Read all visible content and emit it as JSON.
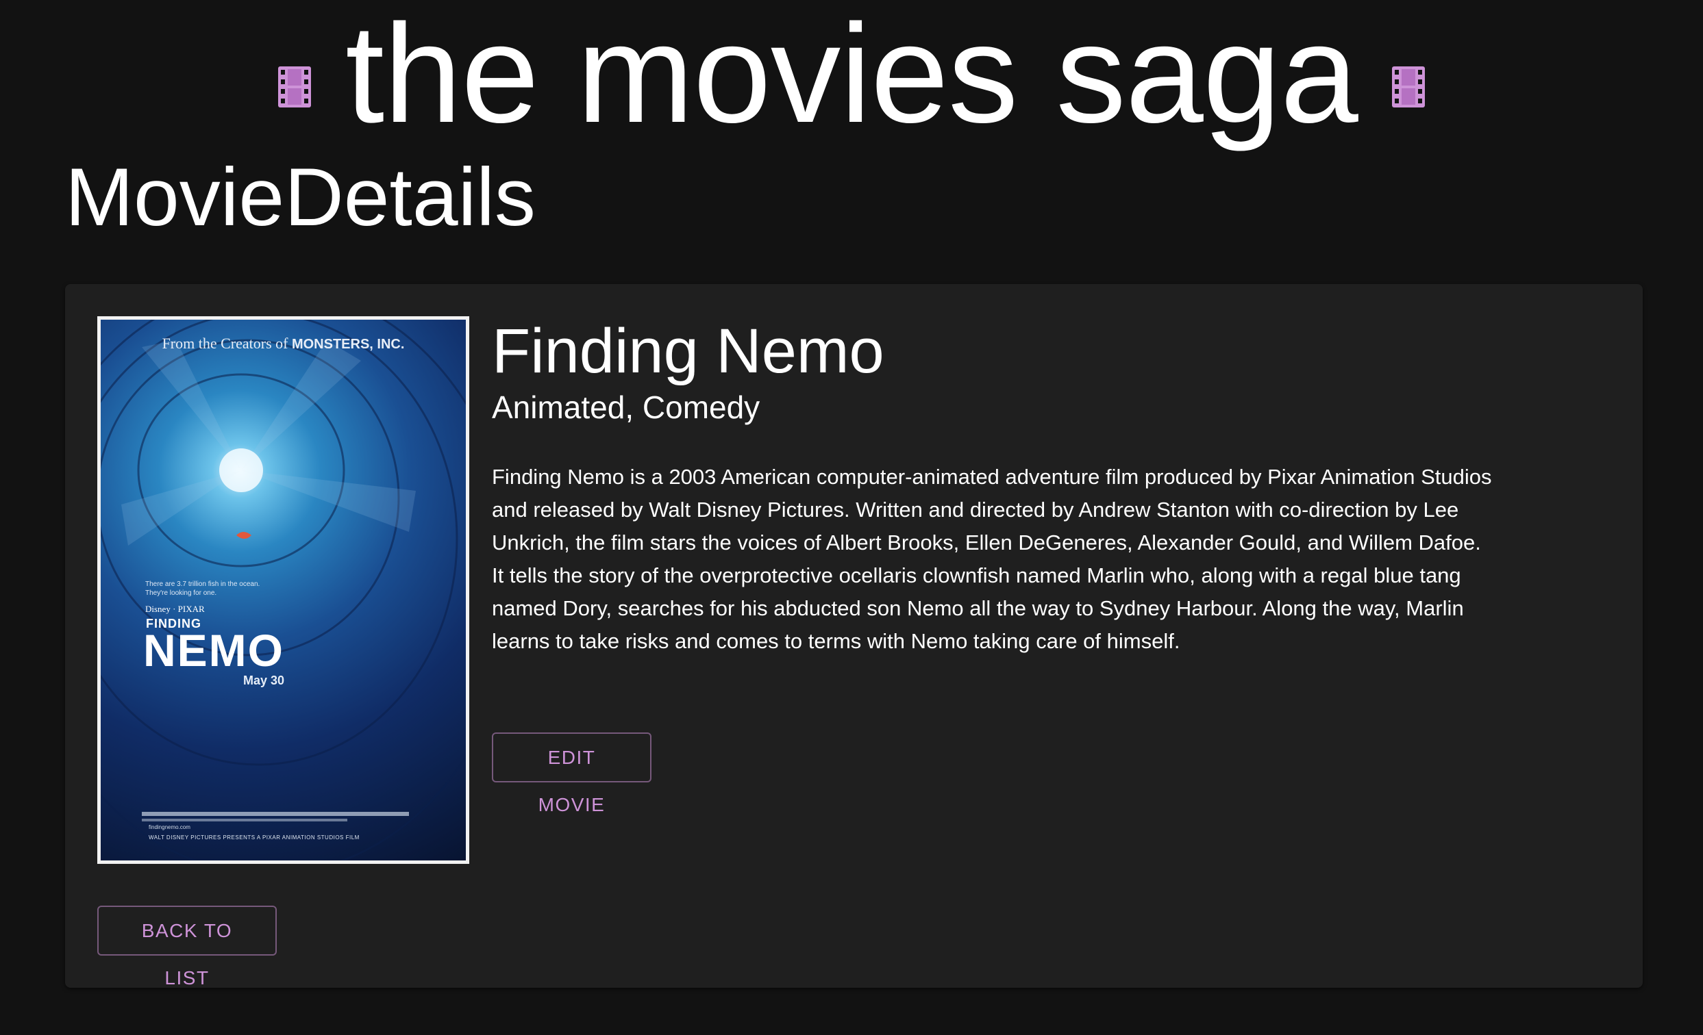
{
  "header": {
    "site_title": "the movies saga",
    "left_icon": "film-icon",
    "right_icon": "film-icon",
    "icon_color": "#ce93d8"
  },
  "page": {
    "title": "MovieDetails"
  },
  "movie": {
    "title": "Finding Nemo",
    "genres": "Animated, Comedy",
    "description": "Finding Nemo is a 2003 American computer-animated adventure film produced by Pixar Animation Studios and released by Walt Disney Pictures. Written and directed by Andrew Stanton with co-direction by Lee Unkrich, the film stars the voices of Albert Brooks, Ellen DeGeneres, Alexander Gould, and Willem Dafoe. It tells the story of the overprotective ocellaris clownfish named Marlin who, along with a regal blue tang named Dory, searches for his abducted son Nemo all the way to Sydney Harbour. Along the way, Marlin learns to take risks and comes to terms with Nemo taking care of himself.",
    "poster": {
      "tag_prefix": "From the Creators of",
      "tag_brand": "MONSTERS, INC.",
      "tagline": "There are 3.7 trillion fish in the ocean. They're looking for one.",
      "studio": "Disney · PIXAR",
      "logo_small": "FINDING",
      "logo_big": "NEMO",
      "release": "May 30",
      "url": "findingnemo.com",
      "credits": "WALT DISNEY PICTURES PRESENTS A PIXAR ANIMATION STUDIOS FILM"
    }
  },
  "actions": {
    "edit_label": "EDIT MOVIE",
    "back_label": "BACK TO LIST"
  },
  "colors": {
    "background": "#121212",
    "card": "#1f1f1f",
    "accent": "#ce93d8",
    "text": "#ffffff"
  }
}
